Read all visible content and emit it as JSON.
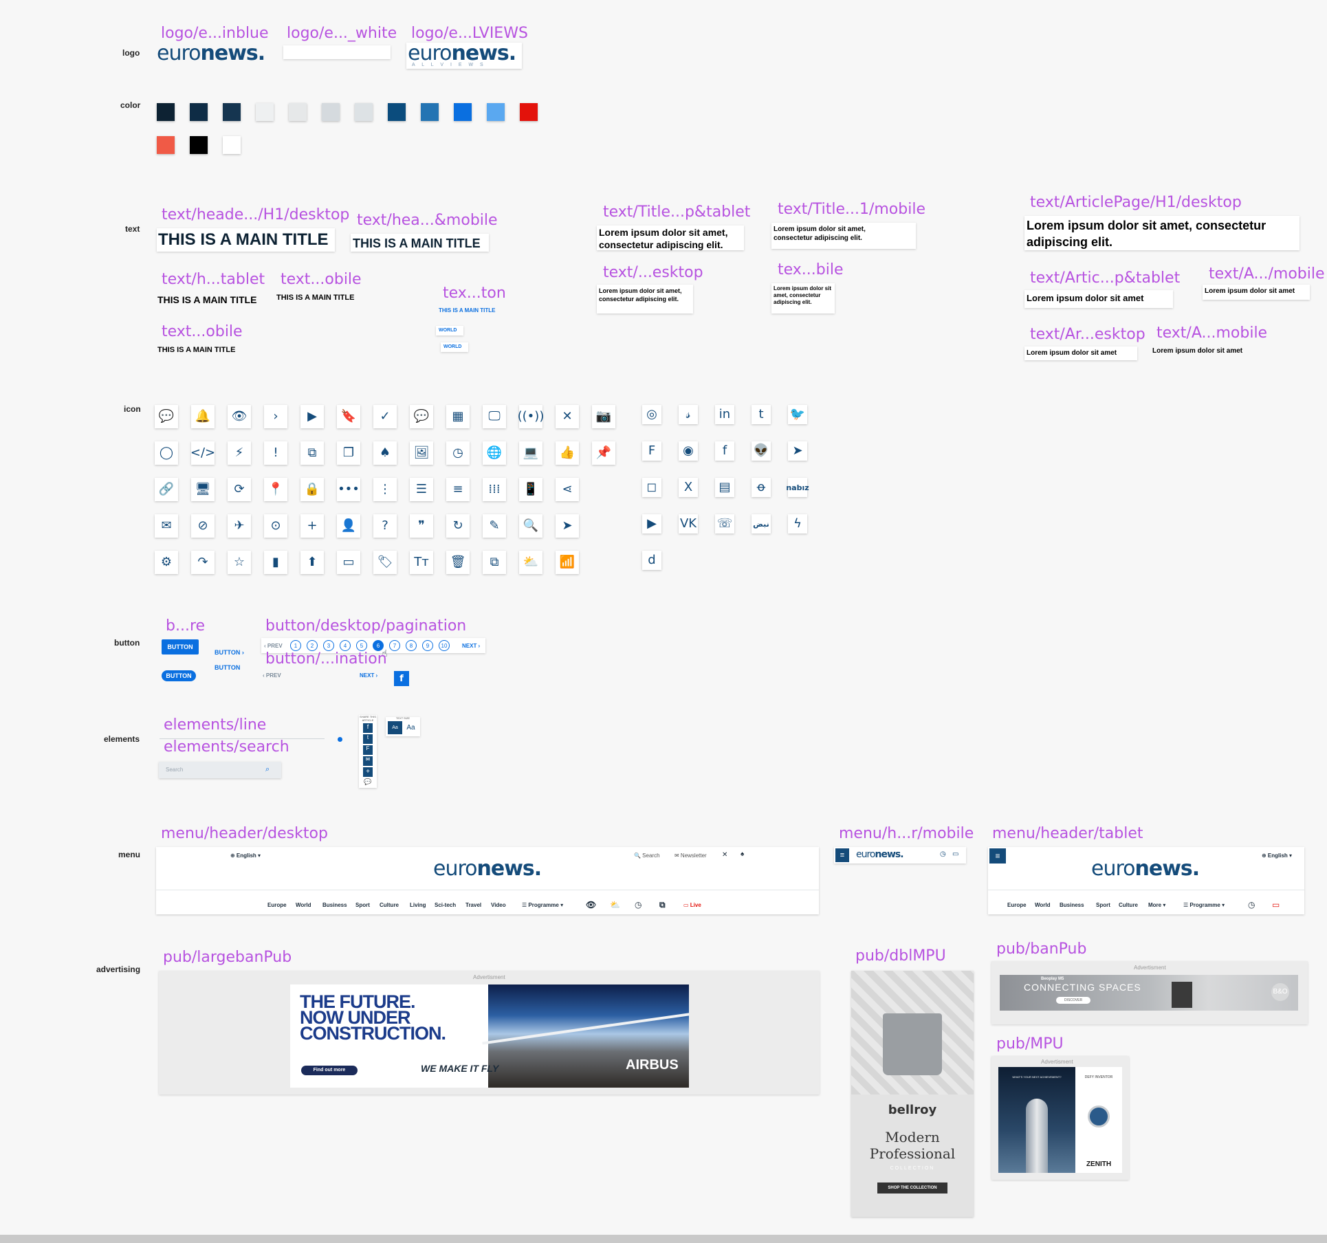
{
  "sections": {
    "logo": "logo",
    "color": "color",
    "text": "text",
    "icon": "icon",
    "button": "button",
    "elements": "elements",
    "menu": "menu",
    "advertising": "advertising"
  },
  "labels": {
    "logo_inblue": "logo/e...inblue",
    "logo_white": "logo/e..._white",
    "logo_allviews": "logo/e...LVIEWS",
    "text_h1_desktop": "text/heade.../H1/desktop",
    "text_h_mobile": "text/hea...&mobile",
    "text_h_tablet": "text/h...tablet",
    "text_obile1": "text...obile",
    "text_obile2": "text...obile",
    "text_ton": "tex...ton",
    "text_title_tablet": "text/Title...p&tablet",
    "text_title_mobile": "text/Title...1/mobile",
    "text_esktop": "text/...esktop",
    "text_bile": "tex...bile",
    "text_article_h1": "text/ArticlePage/H1/desktop",
    "text_artic_tablet": "text/Artic...p&tablet",
    "text_a_mobile": "text/A.../mobile",
    "text_ar_esktop": "text/Ar...esktop",
    "text_a_mobile2": "text/A...mobile",
    "button_re": "b...re",
    "button_pagination": "button/desktop/pagination",
    "button_ination": "button/...ination",
    "elements_line": "elements/line",
    "elements_search": "elements/search",
    "menu_desktop": "menu/header/desktop",
    "menu_mobile": "menu/h...r/mobile",
    "menu_tablet": "menu/header/tablet",
    "pub_large": "pub/largebanPub",
    "pub_dbl": "pub/dblMPU",
    "pub_ban": "pub/banPub",
    "pub_mpu": "pub/MPU"
  },
  "logo": {
    "light": "euro",
    "bold": "news.",
    "allviews": "A L L   V I E W S"
  },
  "colors": [
    "#0d2233",
    "#0e2c45",
    "#153550",
    "#eef0f1",
    "#e6e8e9",
    "#d5dade",
    "#dde2e5",
    "#0b4c7d",
    "#2474b3",
    "#0a6fe0",
    "#5aa8f0",
    "#e3120b",
    "#f05a46",
    "#000000",
    "#ffffff"
  ],
  "text_samples": {
    "main_title": "THIS IS A MAIN TITLE",
    "lorem_full": "Lorem ipsum dolor sit amet, consectetur adipiscing elit.",
    "lorem_short": "Lorem ipsum dolor sit amet",
    "world": "WORLD"
  },
  "icons_main": [
    "💬",
    "🔔",
    "👁",
    "›",
    "▶",
    "🔖",
    "✓",
    "💬",
    "▦",
    "🖵",
    "((•))",
    "✕",
    "📷",
    "◯",
    "</>",
    "⚡",
    "!",
    "⧉",
    "❐",
    "♠",
    "🖼",
    "◷",
    "🌐",
    "💻",
    "👍",
    "📌",
    "🔗",
    "🖥",
    "⟳",
    "📍",
    "🔒",
    "•••",
    "⋮",
    "☰",
    "≡",
    "⁞⁞⁞",
    "📱",
    "⋖",
    "✉",
    "⊘",
    "✈",
    "⊙",
    "+",
    "👤",
    "?",
    "❞",
    "↻",
    "✎",
    "🔍",
    "➤",
    "⚙",
    "↷",
    "☆",
    "▮",
    "⬆",
    "▭",
    "🏷",
    "Tт",
    "🗑",
    "⧉",
    "⛅",
    "📶"
  ],
  "icons_social": [
    "◎",
    "𝓈",
    "in",
    "t",
    "🐦",
    "F",
    "◉",
    "f",
    "👽",
    "➤",
    "◻",
    "X",
    "▤",
    "ꝋ",
    "nabız",
    "▶",
    "VK",
    "☏",
    "نبض",
    "ϟ",
    "d"
  ],
  "buttons": {
    "button": "BUTTON",
    "prev": "‹ PREV",
    "next": "NEXT ›",
    "pages": [
      "1",
      "2",
      "3",
      "4",
      "5",
      "6",
      "7",
      "8",
      "9",
      "10"
    ]
  },
  "share": {
    "share_title": "SHARE THIS ARTICLE",
    "text_size": "TEXT SIZE",
    "aa": "Aa"
  },
  "search": {
    "placeholder": "Search"
  },
  "menu": {
    "lang": "⊕ English ▾",
    "search": "🔍 Search",
    "newsletter": "✉ Newsletter",
    "nav_desktop": [
      "Europe",
      "World",
      "Business",
      "Sport",
      "Culture",
      "Living",
      "Sci-tech",
      "Travel",
      "Video"
    ],
    "programme": "☰ Programme ▾",
    "live": "Live",
    "nav_tablet": [
      "Europe",
      "World",
      "Business",
      "Sport",
      "Culture",
      "More ▾"
    ]
  },
  "ads": {
    "advertisement": "Advertisment",
    "airbus_headline": "THE FUTURE. NOW UNDER CONSTRUCTION.",
    "airbus_cta": "Find out more",
    "airbus_tag": "WE MAKE IT FLY",
    "airbus_brand": "AIRBUS",
    "bellroy_brand": "bellroy",
    "bellroy_title": "Modern Professional",
    "bellroy_sub": "COLLECTION",
    "bellroy_cta": "SHOP THE COLLECTION",
    "bo_title": "CONNECTING SPACES",
    "bo_product": "Beoplay M5",
    "bo_cta": "DISCOVER",
    "zenith_q": "WHAT'S YOUR NEXT ACHIEVEMENT?",
    "zenith_tag": "DEFY INVENTOR",
    "zenith_brand": "ZENITH"
  }
}
